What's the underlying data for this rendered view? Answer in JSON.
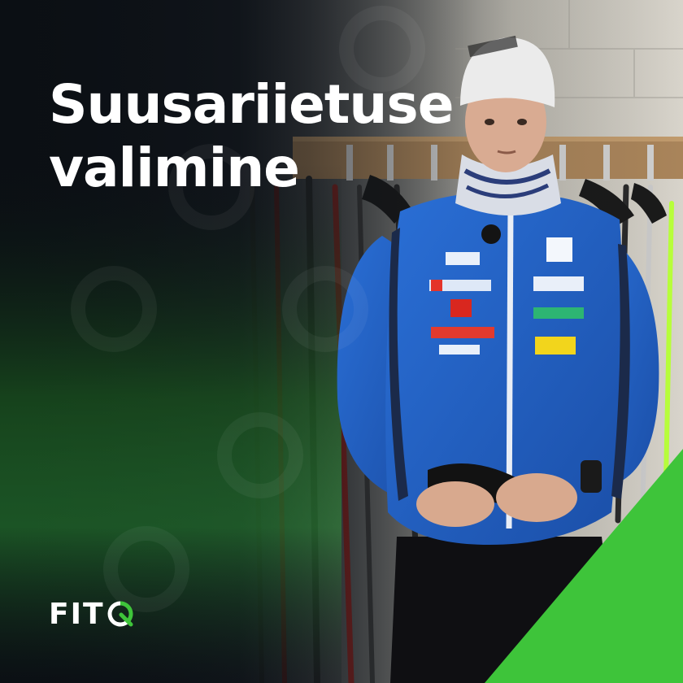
{
  "title": {
    "line1": "Suusariietuse",
    "line2": "valimine"
  },
  "logo": {
    "text": "FIT",
    "icon": "q-logo-icon"
  },
  "colors": {
    "background": "#0d1117",
    "accent_green": "#3ec43a",
    "jacket_blue": "#1f5fc8",
    "text": "#ffffff"
  }
}
